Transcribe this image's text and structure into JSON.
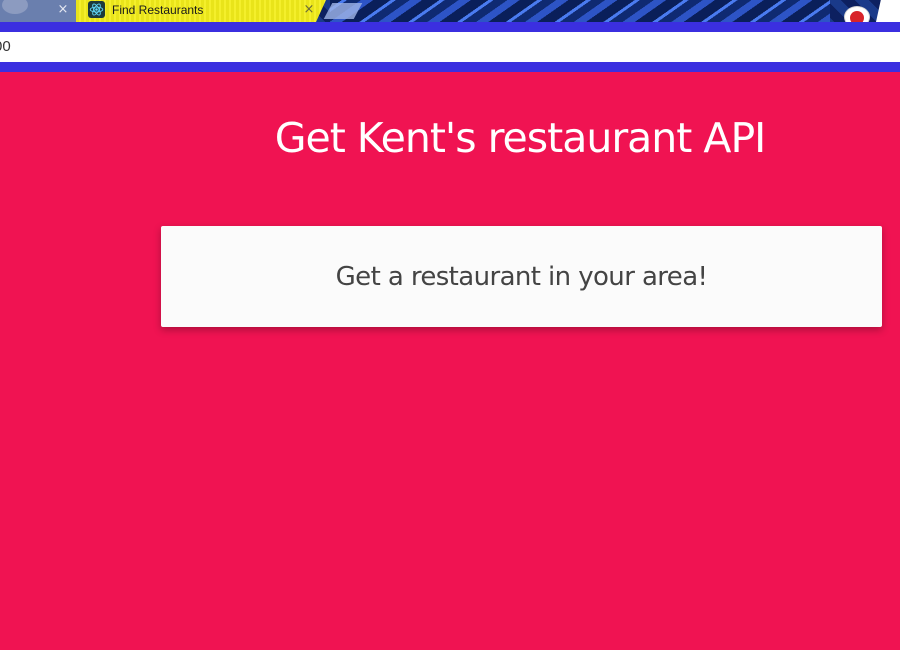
{
  "browser": {
    "tabs": [
      {
        "label": "",
        "active": false
      },
      {
        "label": "Find Restaurants",
        "active": true
      }
    ],
    "close_glyph": "×",
    "address": "00"
  },
  "page": {
    "heading": "Get Kent's restaurant API",
    "card_label": "Get a restaurant in your area!"
  },
  "colors": {
    "background": "#f01352",
    "heading_text": "#ffffff",
    "card_background": "#fbfbfb",
    "card_text": "#444444",
    "url_bar_border": "#3b2fe0",
    "active_tab": "#f4ef2b"
  },
  "icons": {
    "favicon": "react-logo-icon",
    "profile": "profile-avatar-icon"
  }
}
